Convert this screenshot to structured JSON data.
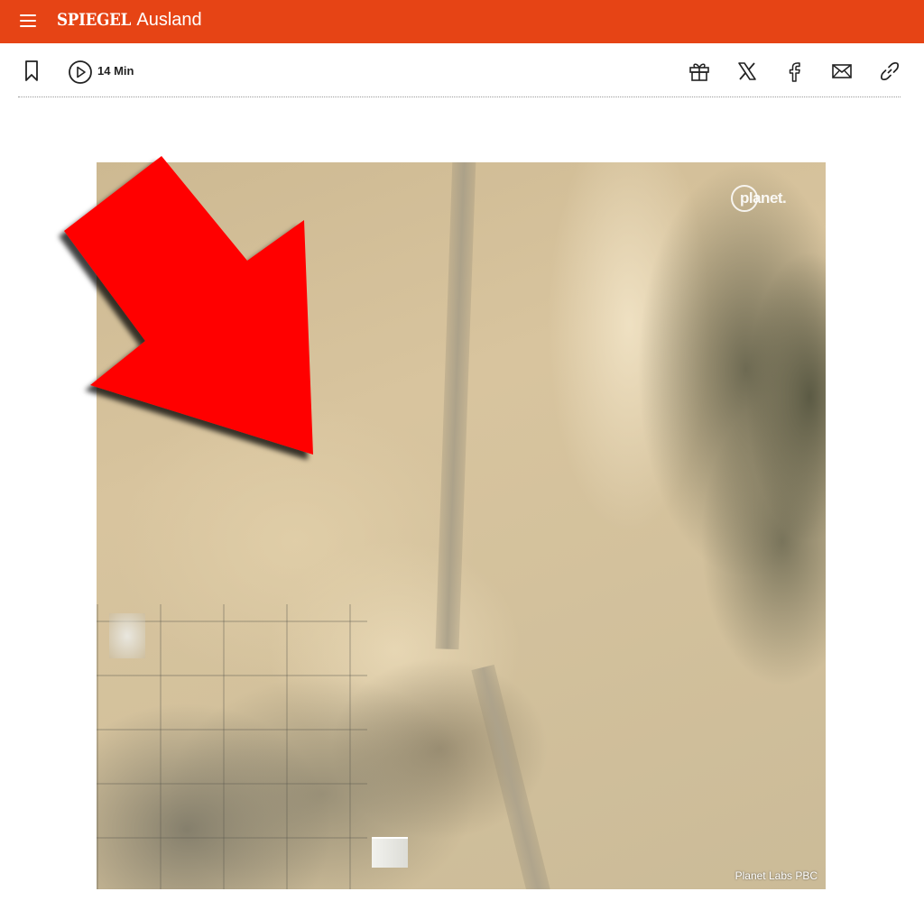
{
  "header": {
    "brand_logo": "SPIEGEL",
    "section": "Ausland",
    "background_color": "#e64415"
  },
  "toolbar": {
    "bookmark_icon": "bookmark-icon",
    "play_icon": "play-icon",
    "reading_time": "14 Min",
    "share_icons": [
      "gift-icon",
      "x-icon",
      "facebook-icon",
      "mail-icon",
      "link-icon"
    ]
  },
  "figure": {
    "watermark": "planet.",
    "credit": "Planet Labs PBC",
    "arrow_color": "#ff0000"
  }
}
